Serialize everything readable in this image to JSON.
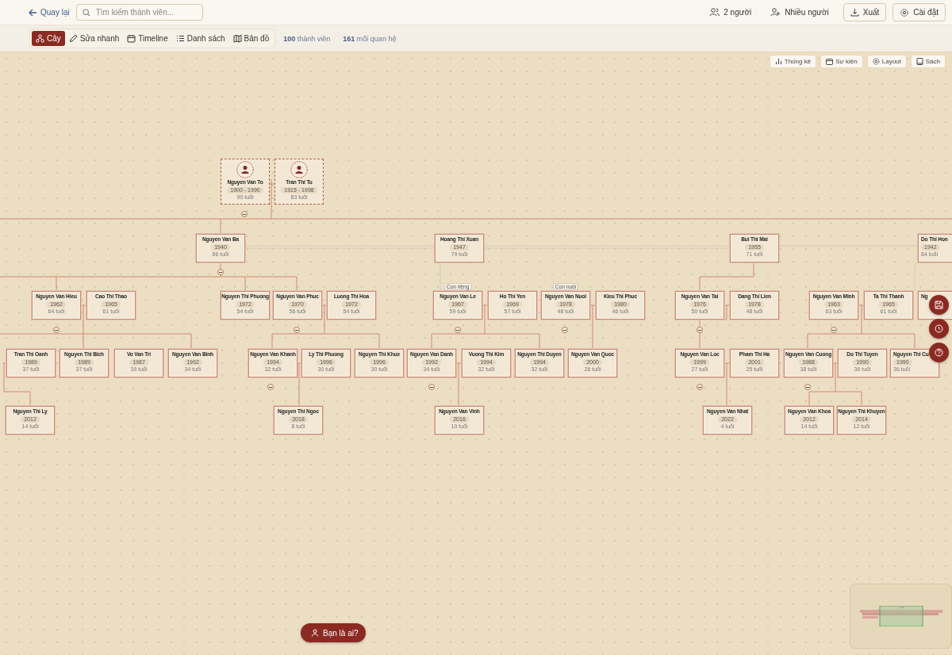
{
  "header": {
    "back": "Quay lại",
    "search": {
      "placeholder": "Tìm kiếm thành viên..."
    },
    "actions": [
      {
        "kind": "people",
        "label": "2 người"
      },
      {
        "kind": "group",
        "label": "Nhiều người"
      },
      {
        "kind": "export",
        "label": "Xuất"
      },
      {
        "kind": "settings",
        "label": "Cài đặt"
      }
    ]
  },
  "views": [
    {
      "kind": "tree",
      "label": "Cây",
      "selected": true
    },
    {
      "kind": "edit",
      "label": "Sửa nhanh",
      "selected": false
    },
    {
      "kind": "timeline",
      "label": "Timeline",
      "selected": false
    },
    {
      "kind": "list",
      "label": "Danh sách",
      "selected": false
    },
    {
      "kind": "map",
      "label": "Bản đồ",
      "selected": false
    }
  ],
  "stats": [
    "**100** thành viên",
    "**161** mối quan hệ"
  ],
  "canvas_tools": [
    {
      "kind": "stats",
      "label": "Thống kê"
    },
    {
      "kind": "events",
      "label": "Sự kiện"
    },
    {
      "kind": "layout",
      "label": "Layout"
    },
    {
      "kind": "book",
      "label": "Sách"
    }
  ],
  "tree": {
    "nodes": [
      {
        "name": "Nguyen Van To",
        "years": "1900 - 1990",
        "age": "90 tuổi",
        "deceased": true
      },
      {
        "name": "Tran Thi Tu",
        "years": "1915 - 1998",
        "age": "83 tuổi",
        "deceased": true
      },
      {
        "name": "Nguyen Van Ba",
        "years": "1940",
        "age": "86 tuổi",
        "deceased": false
      },
      {
        "name": "Hoang Thi Xuan",
        "years": "1947",
        "age": "79 tuổi",
        "deceased": false
      },
      {
        "name": "Bui Thi Mai",
        "years": "1955",
        "age": "71 tuổi",
        "deceased": false
      },
      {
        "name": "Do Thi Hon",
        "years": "1942",
        "age": "84 tuổi",
        "deceased": false
      },
      {
        "name": "Nguyen Van Hieu",
        "years": "1962",
        "age": "64 tuổi",
        "deceased": false
      },
      {
        "name": "Cao Thi Thao",
        "years": "1965",
        "age": "61 tuổi",
        "deceased": false
      },
      {
        "name": "Nguyen Thi Phuong",
        "years": "1972",
        "age": "54 tuổi",
        "deceased": false
      },
      {
        "name": "Nguyen Van Phuc",
        "years": "1970",
        "age": "56 tuổi",
        "deceased": false
      },
      {
        "name": "Luong Thi Hoa",
        "years": "1972",
        "age": "54 tuổi",
        "deceased": false
      },
      {
        "name": "Nguyen Van Le",
        "years": "1967",
        "age": "59 tuổi",
        "deceased": false,
        "tag": "Con riêng"
      },
      {
        "name": "Ho Thi Yen",
        "years": "1969",
        "age": "57 tuổi",
        "deceased": false
      },
      {
        "name": "Nguyen Van Nuoi",
        "years": "1978",
        "age": "48 tuổi",
        "deceased": false,
        "tag": "Con nuôi"
      },
      {
        "name": "Kieu Thi Phuc",
        "years": "1980",
        "age": "46 tuổi",
        "deceased": false
      },
      {
        "name": "Nguyen Van Tai",
        "years": "1976",
        "age": "50 tuổi",
        "deceased": false
      },
      {
        "name": "Dang Thi Lien",
        "years": "1978",
        "age": "48 tuổi",
        "deceased": false
      },
      {
        "name": "Nguyen Van Minh",
        "years": "1963",
        "age": "63 tuổi",
        "deceased": false
      },
      {
        "name": "Ta Thi Thanh",
        "years": "1965",
        "age": "61 tuổi",
        "deceased": false
      },
      {
        "name": "Ng",
        "deceased": false
      },
      {
        "name": "Tran Thi Oanh",
        "years": "1989",
        "age": "37 tuổi",
        "deceased": false
      },
      {
        "name": "Nguyen Thi Bich",
        "years": "1989",
        "age": "37 tuổi",
        "deceased": false
      },
      {
        "name": "Vo Van Tri",
        "years": "1987",
        "age": "39 tuổi",
        "deceased": false
      },
      {
        "name": "Nguyen Van Binh",
        "years": "1992",
        "age": "34 tuổi",
        "deceased": false
      },
      {
        "name": "Nguyen Van Khanh",
        "years": "1994",
        "age": "32 tuổi",
        "deceased": false
      },
      {
        "name": "Ly Thi Phuong",
        "years": "1996",
        "age": "30 tuổi",
        "deceased": false
      },
      {
        "name": "Nguyen Thi Khue",
        "years": "1996",
        "age": "30 tuổi",
        "deceased": false
      },
      {
        "name": "Nguyen Van Danh",
        "years": "1992",
        "age": "34 tuổi",
        "deceased": false
      },
      {
        "name": "Vuong Thi Kim",
        "years": "1994",
        "age": "32 tuổi",
        "deceased": false
      },
      {
        "name": "Nguyen Thi Duyen",
        "years": "1994",
        "age": "32 tuổi",
        "deceased": false
      },
      {
        "name": "Nguyen Van Quoc",
        "years": "2000",
        "age": "26 tuổi",
        "deceased": false
      },
      {
        "name": "Nguyen Van Loc",
        "years": "1999",
        "age": "27 tuổi",
        "deceased": false
      },
      {
        "name": "Pham Thi Ha",
        "years": "2001",
        "age": "25 tuổi",
        "deceased": false
      },
      {
        "name": "Nguyen Van Cuong",
        "years": "1988",
        "age": "38 tuổi",
        "deceased": false
      },
      {
        "name": "Do Thi Tuyen",
        "years": "1990",
        "age": "36 tuổi",
        "deceased": false
      },
      {
        "name": "Nguyen Thi Cu",
        "years": "1990",
        "age": "36 tuổi",
        "deceased": false
      },
      {
        "name": "Nguyen Thi Ly",
        "years": "2012",
        "age": "14 tuổi",
        "deceased": false
      },
      {
        "name": "Nguyen Thi Ngoc",
        "years": "2018",
        "age": "8 tuổi",
        "deceased": false
      },
      {
        "name": "Nguyen Van Vinh",
        "years": "2016",
        "age": "10 tuổi",
        "deceased": false
      },
      {
        "name": "Nguyen Van Nhat",
        "years": "2022",
        "age": "4 tuổi",
        "deceased": false
      },
      {
        "name": "Nguyen Van Khoa",
        "years": "2012",
        "age": "14 tuổi",
        "deceased": false
      },
      {
        "name": "Nguyen Thi Khuyen",
        "years": "2014",
        "age": "12 tuổi",
        "deceased": false
      }
    ]
  },
  "floating_actions": [
    {
      "kind": "save"
    },
    {
      "kind": "history"
    },
    {
      "kind": "help"
    }
  ],
  "identify_button": "Bạn là ai?"
}
